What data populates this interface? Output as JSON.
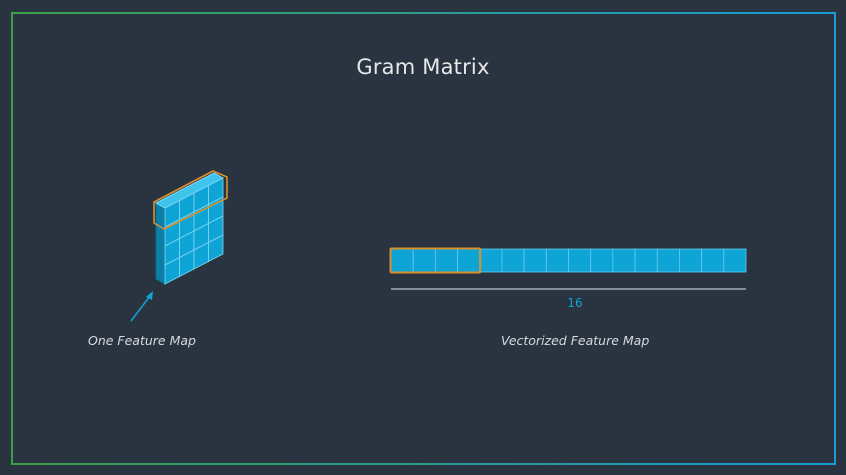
{
  "title": "Gram Matrix",
  "feature_map": {
    "caption": "One Feature Map",
    "rows": 4,
    "cols": 4,
    "highlighted_row": 1
  },
  "vector": {
    "caption": "Vectorized Feature Map",
    "length_label": "16",
    "cells": 16,
    "highlighted_cells": 4
  },
  "colors": {
    "background": "#2a3340",
    "cell_fill": "#0ea5d6",
    "cell_side": "#0b7fa8",
    "cell_top": "#3ec3ec",
    "highlight": "#d9912d",
    "border_green": "#3aa14a",
    "border_blue": "#1a9ad6"
  }
}
